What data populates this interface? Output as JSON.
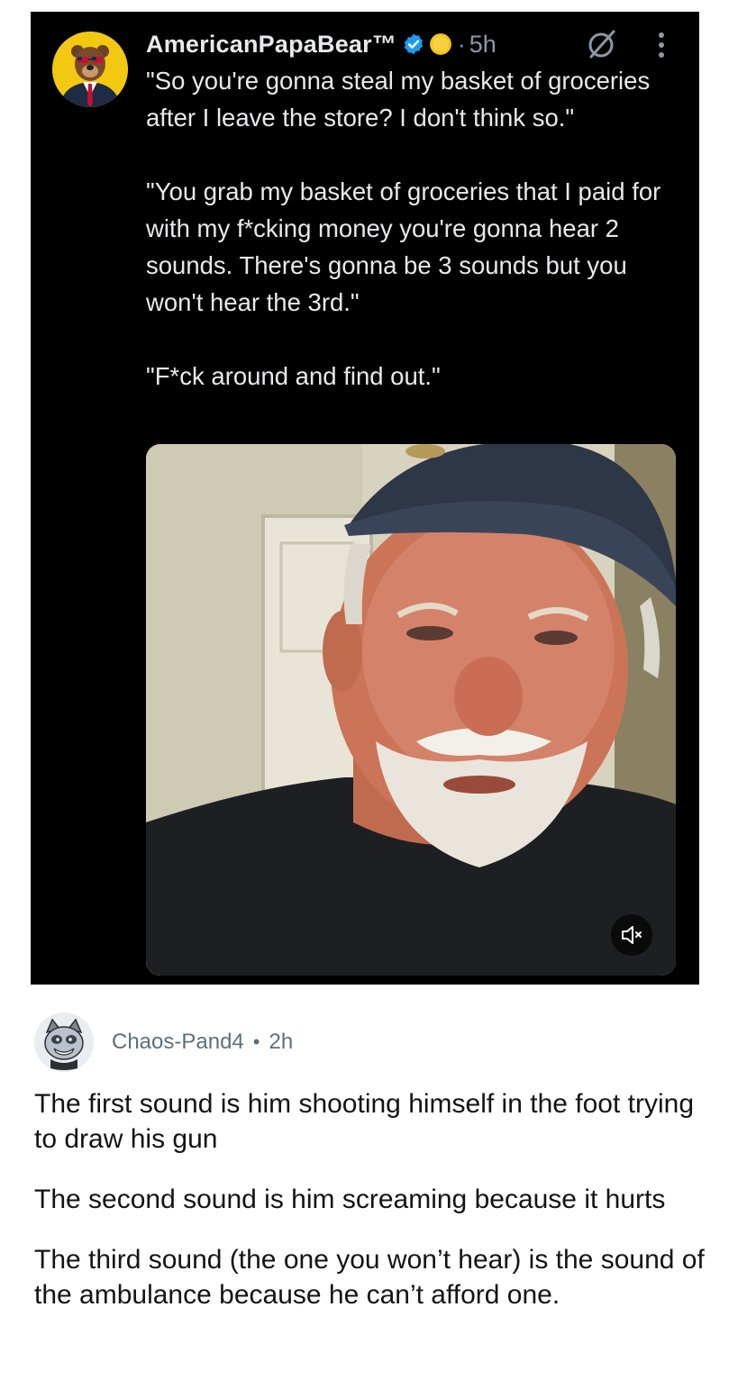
{
  "tweet": {
    "author": "AmericanPapaBear™",
    "separator": "·",
    "time": "5h",
    "paragraphs": [
      "\"So you're gonna steal my basket of groceries after I leave the store? I don't think so.\"",
      "\"You grab my basket of groceries that I paid for with my f*cking money you're gonna hear 2 sounds. There's gonna be 3 sounds but you won't hear the 3rd.\"",
      "\"F*ck around and find out.\""
    ],
    "icons": {
      "verified": "verified-badge-icon",
      "coin": "gold-coin-icon",
      "grok": "grok-icon",
      "more": "more-options-icon",
      "mute": "muted-speaker-icon"
    },
    "colors": {
      "background": "#000000",
      "text": "#e7e9ea",
      "secondary": "#8b98a5",
      "verified": "#1d9bf0",
      "avatar_bg": "#f2c811"
    }
  },
  "comment": {
    "username": "Chaos-Pand4",
    "separator": "•",
    "time": "2h",
    "paragraphs": [
      "The first sound is him shooting himself in the foot trying to draw his gun",
      "The second sound is him screaming because it hurts",
      "The third sound (the one you won’t hear) is the sound of the ambulance because he can’t afford one."
    ]
  }
}
